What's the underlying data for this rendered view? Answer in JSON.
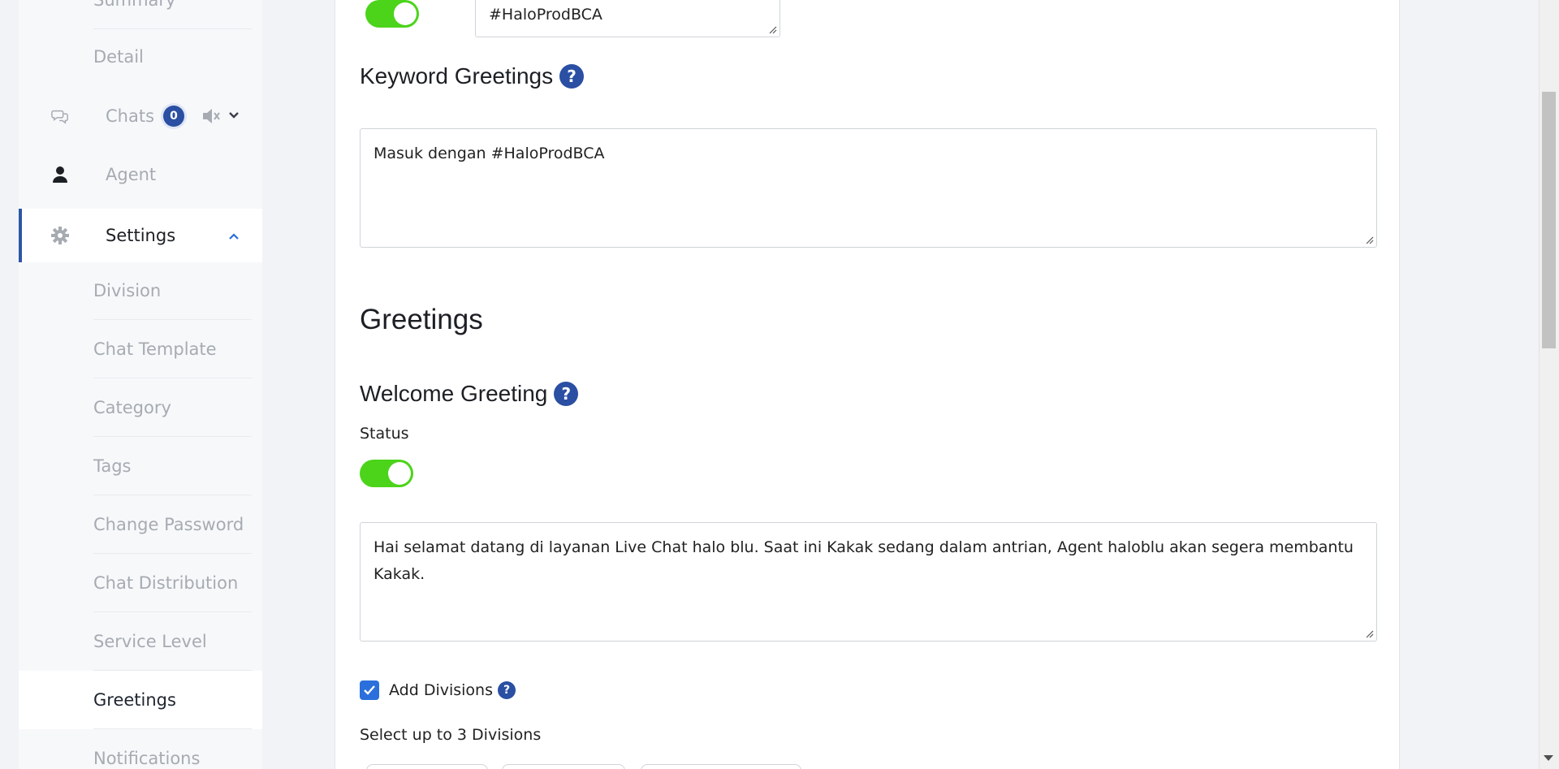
{
  "sidebar": {
    "top_items": [
      {
        "label": "Summary"
      },
      {
        "label": "Detail"
      }
    ],
    "chats": {
      "label": "Chats",
      "badge": "0",
      "icon": "chat-bubbles-icon",
      "mute_icon": "speaker-muted-icon",
      "chevron_icon": "chevron-down-icon"
    },
    "agent": {
      "label": "Agent",
      "icon": "user-icon"
    },
    "settings": {
      "label": "Settings",
      "icon": "gear-icon",
      "chevron_icon": "chevron-up-icon"
    },
    "settings_items": [
      {
        "label": "Division"
      },
      {
        "label": "Chat Template"
      },
      {
        "label": "Category"
      },
      {
        "label": "Tags"
      },
      {
        "label": "Change Password"
      },
      {
        "label": "Chat Distribution"
      },
      {
        "label": "Service Level"
      },
      {
        "label": "Greetings"
      },
      {
        "label": "Notifications"
      }
    ],
    "active_item": "Greetings"
  },
  "main": {
    "top_keyword_value": "#HaloProdBCA",
    "keyword_greetings": {
      "title": "Keyword Greetings",
      "help": "?",
      "value": "Masuk dengan #HaloProdBCA"
    },
    "greetings_heading": "Greetings",
    "welcome_greeting": {
      "title": "Welcome Greeting",
      "help": "?",
      "status_label": "Status",
      "status_on": true,
      "message": "Hai selamat datang di layanan Live Chat halo blu. Saat ini Kakak sedang dalam antrian, Agent haloblu akan segera membantu Kakak."
    },
    "add_divisions": {
      "label": "Add Divisions",
      "checked": true,
      "help": "?"
    },
    "select_divisions_label": "Select up to 3 Divisions"
  },
  "colors": {
    "accent": "#2a4fa3",
    "toggle_on": "#4bd41a",
    "checkbox": "#2a6fdb"
  }
}
